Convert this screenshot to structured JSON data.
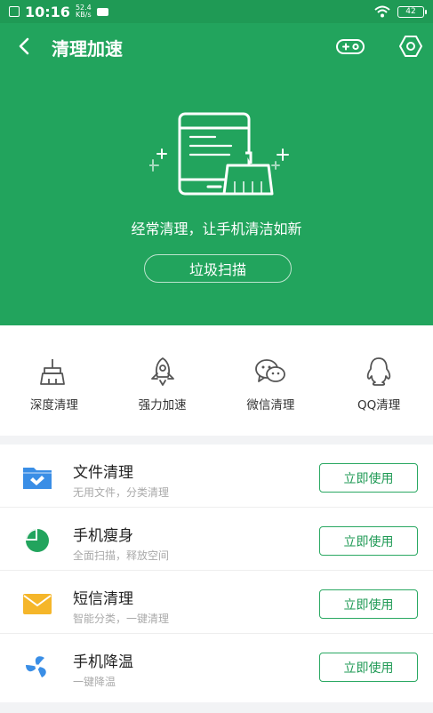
{
  "status": {
    "time": "10:16",
    "speed_value": "52.4",
    "speed_unit": "KB/s",
    "battery": "42"
  },
  "header": {
    "title": "清理加速"
  },
  "hero": {
    "slogan": "经常清理，让手机清洁如新",
    "scan_button": "垃圾扫描"
  },
  "quick_actions": [
    {
      "label": "深度清理",
      "icon": "broom-icon"
    },
    {
      "label": "强力加速",
      "icon": "rocket-icon"
    },
    {
      "label": "微信清理",
      "icon": "wechat-icon"
    },
    {
      "label": "QQ清理",
      "icon": "qq-penguin-icon"
    }
  ],
  "tools": [
    {
      "title": "文件清理",
      "subtitle": "无用文件，分类清理",
      "button": "立即使用",
      "icon": "folder-icon",
      "color": "#3a8ee6"
    },
    {
      "title": "手机瘦身",
      "subtitle": "全面扫描，释放空间",
      "button": "立即使用",
      "icon": "pie-chart-icon",
      "color": "#22a45d"
    },
    {
      "title": "短信清理",
      "subtitle": "智能分类，一键清理",
      "button": "立即使用",
      "icon": "envelope-icon",
      "color": "#f5b62a"
    },
    {
      "title": "手机降温",
      "subtitle": "一键降温",
      "button": "立即使用",
      "icon": "fan-icon",
      "color": "#3a8ee6"
    }
  ],
  "colors": {
    "primary": "#22a45d",
    "status_bar": "#1f9a55",
    "button_text": "#1f9a55"
  }
}
